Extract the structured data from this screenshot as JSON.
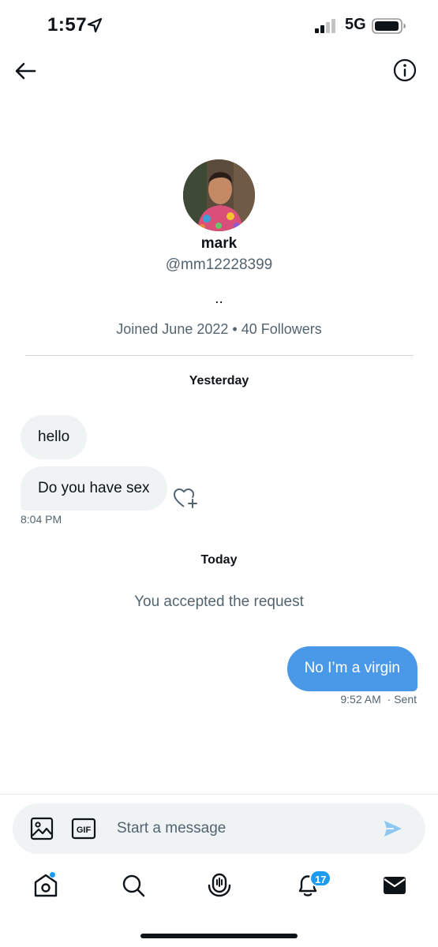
{
  "status_bar": {
    "time": "1:57",
    "network": "5G",
    "icons": [
      "location-arrow-icon",
      "signal-icon",
      "battery-icon"
    ]
  },
  "header": {
    "back_icon": "arrow-left-icon",
    "info_icon": "info-circle-icon"
  },
  "profile": {
    "name": "mark",
    "handle": "@mm12228399",
    "bio": "..",
    "meta": "Joined June 2022 • 40 Followers"
  },
  "conversation": {
    "yesterday_label": "Yesterday",
    "incoming": [
      {
        "text": "hello"
      },
      {
        "text": "Do you have sex"
      }
    ],
    "incoming_time": "8:04 PM",
    "today_label": "Today",
    "system_message": "You accepted the request",
    "outgoing": [
      {
        "text": "No I’m a virgin"
      }
    ],
    "outgoing_time": "9:52 AM",
    "outgoing_status": "· Sent"
  },
  "composer": {
    "placeholder": "Start a message",
    "icons": [
      "image-icon",
      "gif-icon",
      "send-icon"
    ]
  },
  "bottom_nav": {
    "items": [
      "home-icon",
      "search-icon",
      "spaces-icon",
      "notifications-icon",
      "messages-icon"
    ],
    "notifications_count": "17"
  },
  "colors": {
    "accent": "#1d9bf0",
    "outgoing_bubble": "#4a99e9",
    "incoming_bubble": "#eff3f4",
    "secondary_text": "#536471"
  }
}
